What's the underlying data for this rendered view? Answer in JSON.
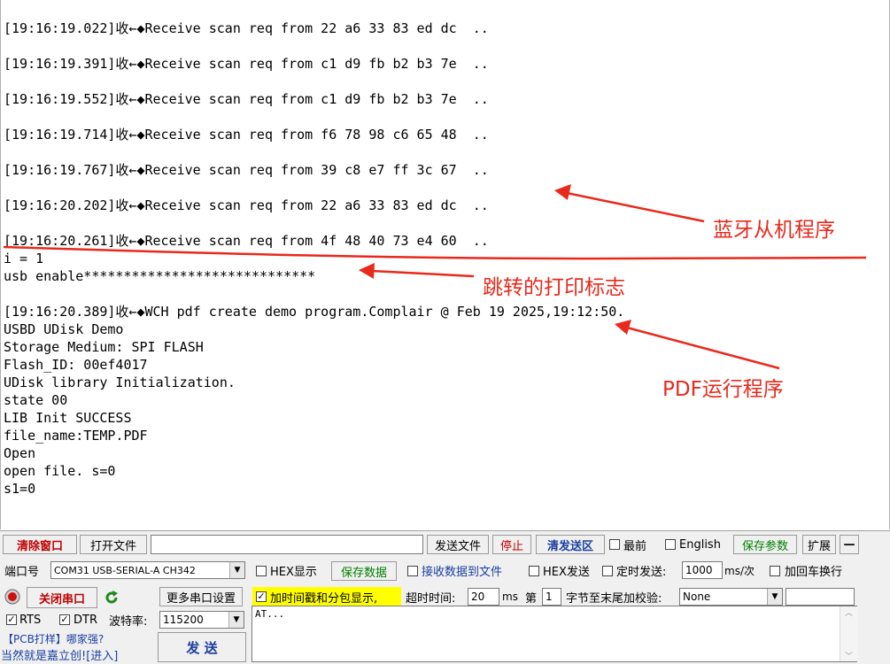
{
  "log_lines": [
    "[19:16:19.022]收←◆Receive scan req from 22 a6 33 83 ed dc  ..",
    "[19:16:19.391]收←◆Receive scan req from c1 d9 fb b2 b3 7e  ..",
    "[19:16:19.552]收←◆Receive scan req from c1 d9 fb b2 b3 7e  ..",
    "[19:16:19.714]收←◆Receive scan req from f6 78 98 c6 65 48  ..",
    "[19:16:19.767]收←◆Receive scan req from 39 c8 e7 ff 3c 67  ..",
    "[19:16:20.202]收←◆Receive scan req from 22 a6 33 83 ed dc  ..",
    "[19:16:20.261]收←◆Receive scan req from 4f 48 40 73 e4 60  ..",
    "i = 1",
    "usb enable*****************************",
    "",
    "[19:16:20.389]收←◆WCH pdf create demo program.Complair @ Feb 19 2025,19:12:50.",
    "USBD UDisk Demo",
    "Storage Medium: SPI FLASH",
    "Flash_ID: 00ef4017",
    "UDisk library Initialization.",
    "state 00",
    "LIB Init SUCCESS",
    "file_name:TEMP.PDF",
    "Open",
    "open file. s=0",
    "s1=0"
  ],
  "annotations": {
    "bluetooth": "蓝牙从机程序",
    "jump": "跳转的打印标志",
    "pdf": "PDF运行程序",
    "color": "#e8291c"
  },
  "toolbar1": {
    "clear_window": "清除窗口",
    "open_file": "打开文件",
    "file_path": "",
    "send_file": "发送文件",
    "stop": "停止",
    "clear_send_area": "清发送区",
    "topmost": "最前",
    "english": "English",
    "save_params": "保存参数",
    "expand": "扩展",
    "minus": "—"
  },
  "row2": {
    "port_label": "端口号",
    "port_value": "COM31 USB-SERIAL-A CH342",
    "hex_display": "HEX显示",
    "save_data": "保存数据",
    "recv_to_file": "接收数据到文件",
    "hex_send": "HEX发送",
    "timed_send": "定时发送:",
    "interval": "1000",
    "interval_unit": "ms/次",
    "add_crlf": "加回车换行"
  },
  "row3": {
    "close_port": "关闭串口",
    "more_settings": "更多串口设置",
    "timestamp": "加时间戳和分包显示,",
    "timeout_label": "超时时间:",
    "timeout_value": "20",
    "timeout_unit": "ms",
    "nth_label": "第",
    "nth_value": "1",
    "checksum_label": "字节至末尾加校验:",
    "checksum_value": "None"
  },
  "row4": {
    "rts": "RTS",
    "dtr": "DTR",
    "baud_label": "波特率:",
    "baud_value": "115200",
    "send_text": "AT..."
  },
  "footer": {
    "ad_line1": "【PCB打样】哪家强?",
    "ad_line2": "当然就是嘉立创![进入]",
    "send": "发  送"
  },
  "checks": {
    "topmost": false,
    "english": false,
    "hex_display": false,
    "recv_to_file": false,
    "hex_send": false,
    "timed_send": false,
    "add_crlf": false,
    "timestamp": true,
    "rts": true,
    "dtr": true
  }
}
